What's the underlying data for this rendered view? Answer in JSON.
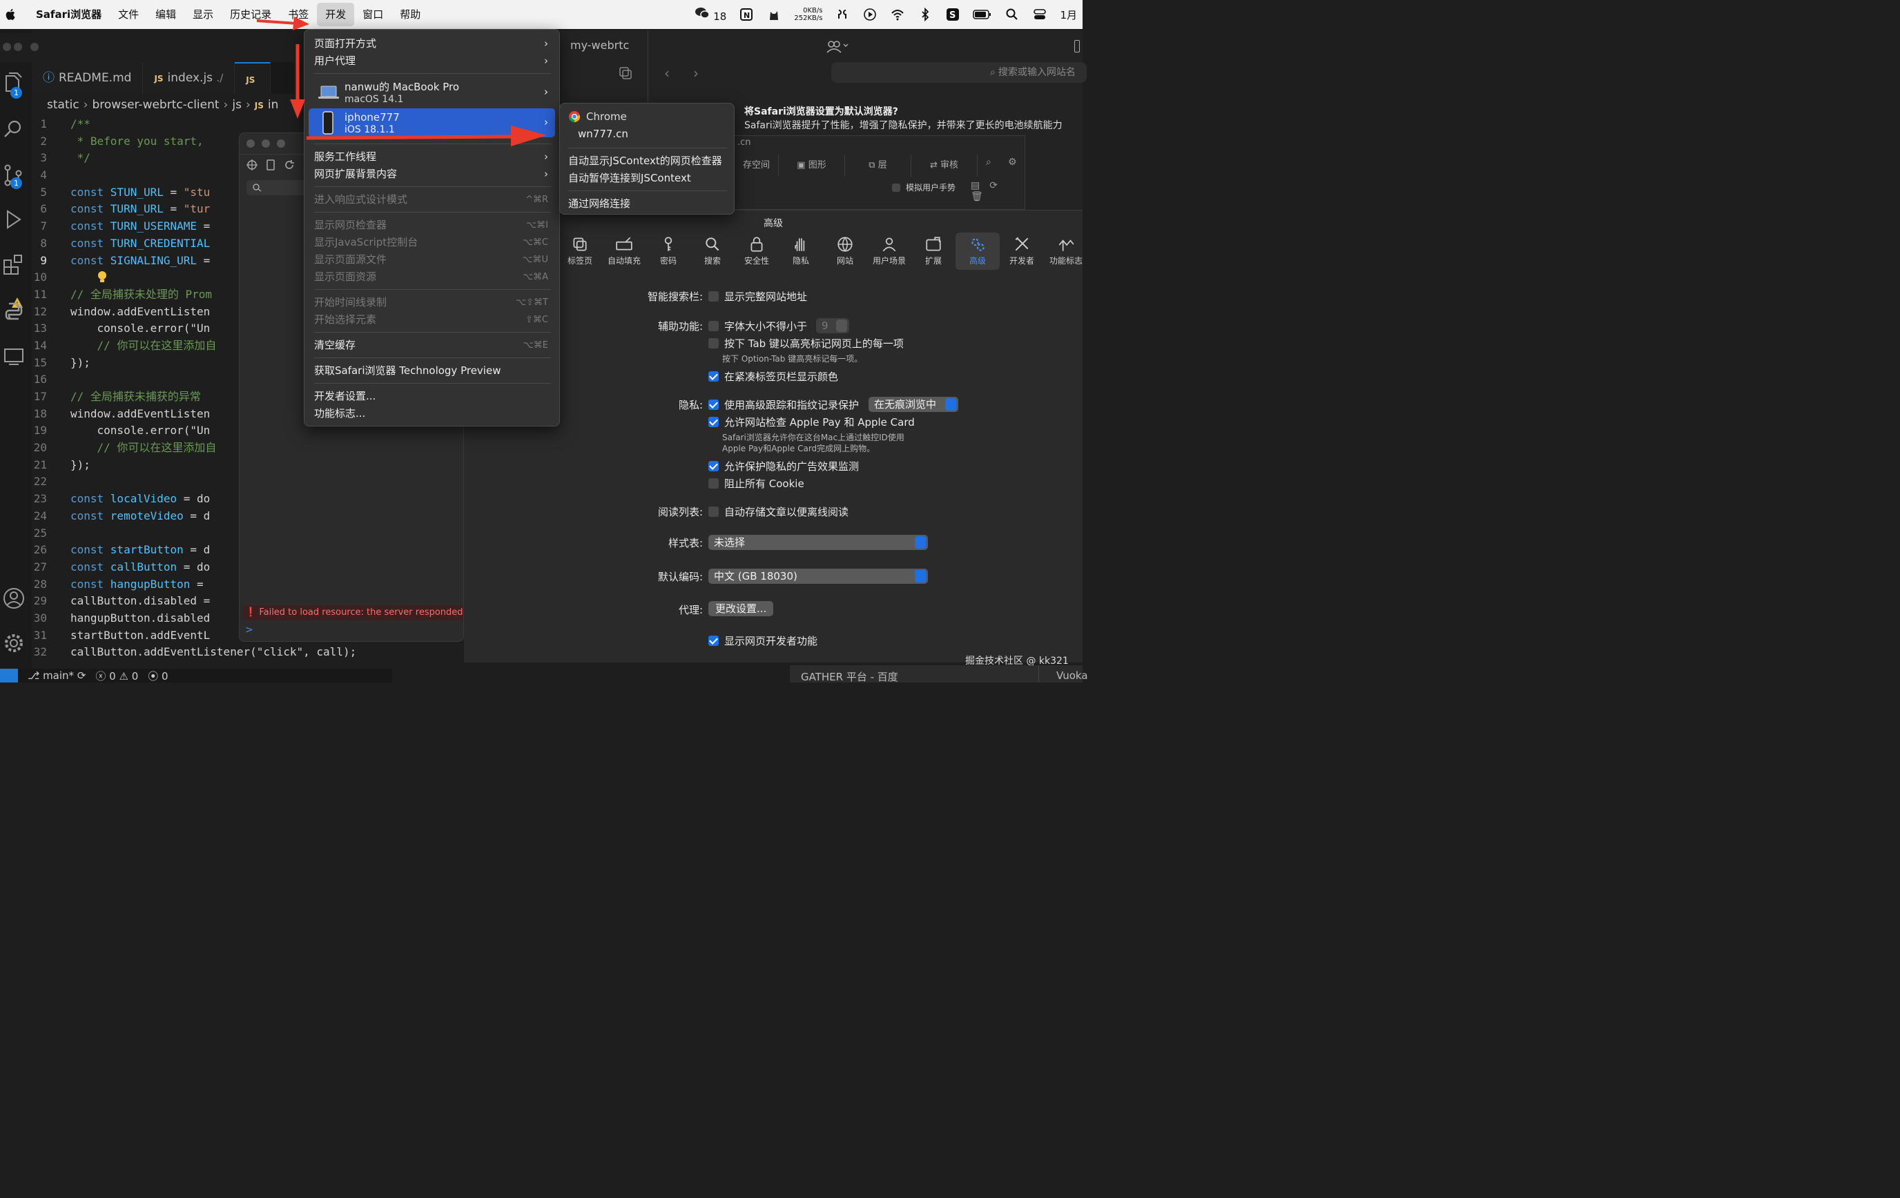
{
  "menubar": {
    "app": "Safari浏览器",
    "menus": [
      "文件",
      "编辑",
      "显示",
      "历史记录",
      "书签",
      "开发",
      "窗口",
      "帮助"
    ],
    "active_index": 5,
    "wechat_count": "18",
    "net_up": "0KB/s",
    "net_down": "252KB/s",
    "date_fragment": "1月"
  },
  "vscode": {
    "tabs": [
      "README.md",
      "index.js",
      "./",
      "in"
    ],
    "breadcrumb": [
      "static",
      "browser-webrtc-client",
      "js",
      "in"
    ],
    "badges": [
      "1",
      "1"
    ],
    "status": {
      "branch": "main*",
      "errors": "0",
      "warnings": "0",
      "ports": "0"
    },
    "lines": [
      {
        "n": "1",
        "text": "/**"
      },
      {
        "n": "2",
        "text": " * Before you start, "
      },
      {
        "n": "3",
        "text": " */"
      },
      {
        "n": "4",
        "text": ""
      },
      {
        "n": "5",
        "kw": "const ",
        "id": "STUN_URL",
        "rest": " = ",
        "str": "\"stu"
      },
      {
        "n": "6",
        "kw": "const ",
        "id": "TURN_URL",
        "rest": " = ",
        "str": "\"tur"
      },
      {
        "n": "7",
        "kw": "const ",
        "id": "TURN_USERNAME",
        "rest": " =",
        "str": ""
      },
      {
        "n": "8",
        "kw": "const ",
        "id": "TURN_CREDENTIAL",
        "rest": "",
        "str": ""
      },
      {
        "n": "9",
        "kw": "const ",
        "id": "SIGNALING_URL",
        "rest": " =",
        "str": ""
      },
      {
        "n": "10",
        "text": ""
      },
      {
        "n": "11",
        "text": "// 全局捕获未处理的 Prom"
      },
      {
        "n": "12",
        "text": "window.addEventListen"
      },
      {
        "n": "13",
        "text": "    console.error(\"Un"
      },
      {
        "n": "14",
        "text": "    // 你可以在这里添加自"
      },
      {
        "n": "15",
        "text": "});"
      },
      {
        "n": "16",
        "text": ""
      },
      {
        "n": "17",
        "text": "// 全局捕获未捕获的异常"
      },
      {
        "n": "18",
        "text": "window.addEventListen"
      },
      {
        "n": "19",
        "text": "    console.error(\"Un"
      },
      {
        "n": "20",
        "text": "    // 你可以在这里添加自"
      },
      {
        "n": "21",
        "text": "});"
      },
      {
        "n": "22",
        "text": ""
      },
      {
        "n": "23",
        "kw": "const ",
        "id": "localVideo",
        "rest": " = do",
        "str": ""
      },
      {
        "n": "24",
        "kw": "const ",
        "id": "remoteVideo",
        "rest": " = d",
        "str": ""
      },
      {
        "n": "25",
        "text": ""
      },
      {
        "n": "26",
        "kw": "const ",
        "id": "startButton",
        "rest": " = d",
        "str": ""
      },
      {
        "n": "27",
        "kw": "const ",
        "id": "callButton",
        "rest": " = do",
        "str": ""
      },
      {
        "n": "28",
        "kw": "const ",
        "id": "hangupButton",
        "rest": " = ",
        "str": ""
      },
      {
        "n": "29",
        "text": "callButton.disabled ="
      },
      {
        "n": "30",
        "text": "hangupButton.disabled"
      },
      {
        "n": "31",
        "text": "startButton.addEventL"
      },
      {
        "n": "32",
        "text": "callButton.addEventListener(\"click\", call);"
      }
    ]
  },
  "inspector": {
    "error": "Failed to load resource: the server responded w",
    "prompt": ">"
  },
  "safari": {
    "tab_title": "my-webrtc",
    "search_placeholder": "搜索或输入网站名",
    "default_title": "将Safari浏览器设置为默认浏览器?",
    "default_body": "Safari浏览器提升了性能，增强了隐私保护，并带来了更长的电池续航能力",
    "wi_url": ".cn",
    "wi_tabs": [
      "存空间",
      "图形",
      "层",
      "审核"
    ],
    "wi_sim": "模拟用户手势"
  },
  "devmenu": {
    "items": [
      {
        "label": "页面打开方式",
        "sub": true
      },
      {
        "label": "用户代理",
        "sub": true
      }
    ],
    "devices": [
      {
        "name": "nanwu的 MacBook Pro",
        "os": "macOS 14.1"
      },
      {
        "name": "iphone777",
        "os": "iOS 18.1.1"
      }
    ],
    "groups": [
      [
        {
          "label": "服务工作线程",
          "sub": true
        },
        {
          "label": "网页扩展背景内容",
          "sub": true
        }
      ],
      [
        {
          "label": "进入响应式设计模式",
          "sc": "^⌘R",
          "dis": true
        }
      ],
      [
        {
          "label": "显示网页检查器",
          "sc": "⌥⌘I",
          "dis": true
        },
        {
          "label": "显示JavaScript控制台",
          "sc": "⌥⌘C",
          "dis": true
        },
        {
          "label": "显示页面源文件",
          "sc": "⌥⌘U",
          "dis": true
        },
        {
          "label": "显示页面资源",
          "sc": "⌥⌘A",
          "dis": true
        }
      ],
      [
        {
          "label": "开始时间线录制",
          "sc": "⌥⇧⌘T",
          "dis": true
        },
        {
          "label": "开始选择元素",
          "sc": "⇧⌘C",
          "dis": true
        }
      ],
      [
        {
          "label": "清空缓存",
          "sc": "⌥⌘E"
        }
      ],
      [
        {
          "label": "获取Safari浏览器 Technology Preview"
        }
      ],
      [
        {
          "label": "开发者设置..."
        },
        {
          "label": "功能标志..."
        }
      ]
    ]
  },
  "submenu": {
    "app": "Chrome",
    "site": "wn777.cn",
    "items": [
      "自动显示JSContext的网页检查器",
      "自动暂停连接到JSContext",
      "通过网络连接"
    ]
  },
  "settings": {
    "title": "高级",
    "toolbar": [
      "标签页",
      "自动填充",
      "密码",
      "搜索",
      "安全性",
      "隐私",
      "网站",
      "用户场景",
      "扩展",
      "高级",
      "开发者",
      "功能标志"
    ],
    "selected_index": 9,
    "smart_search_label": "智能搜索栏:",
    "show_full_address": "显示完整网站地址",
    "a11y_label": "辅助功能:",
    "min_font": "字体大小不得小于",
    "min_font_value": "9",
    "tab_highlight": "按下 Tab 键以高亮标记网页上的每一项",
    "tab_note": "按下 Option-Tab 键高亮标记每一项。",
    "compact_color": "在紧凑标签页栏显示颜色",
    "privacy_label": "隐私:",
    "fingerprint": "使用高级跟踪和指纹记录保护",
    "fingerprint_mode": "在无痕浏览中",
    "apple_pay": "允许网站检查 Apple Pay 和 Apple Card",
    "apple_pay_note": "Safari浏览器允许你在这台Mac上通过触控ID使用\nApple Pay和Apple Card完成网上购物。",
    "ad_measure": "允许保护隐私的广告效果监测",
    "block_cookies": "阻止所有 Cookie",
    "reading_label": "阅读列表:",
    "reading_offline": "自动存储文章以便离线阅读",
    "style_label": "样式表:",
    "style_value": "未选择",
    "encoding_label": "默认编码:",
    "encoding_value": "中文 (GB 18030)",
    "proxy_label": "代理:",
    "proxy_button": "更改设置...",
    "show_dev": "显示网页开发者功能",
    "checked": {
      "full_address": false,
      "min_font": false,
      "tab_highlight": false,
      "compact_color": true,
      "fingerprint": true,
      "apple_pay": true,
      "ad_measure": true,
      "block_cookies": false,
      "reading_offline": false,
      "show_dev": true
    }
  },
  "watermark": "掘金技术社区 @ kk321",
  "bottom_tabs": [
    "GATHER 平台 - 百度",
    "Vuoka"
  ],
  "colors": {
    "accent": "#1f6fe5",
    "annotation": "#e8392b",
    "menu_highlight": "#2b5fd0"
  }
}
